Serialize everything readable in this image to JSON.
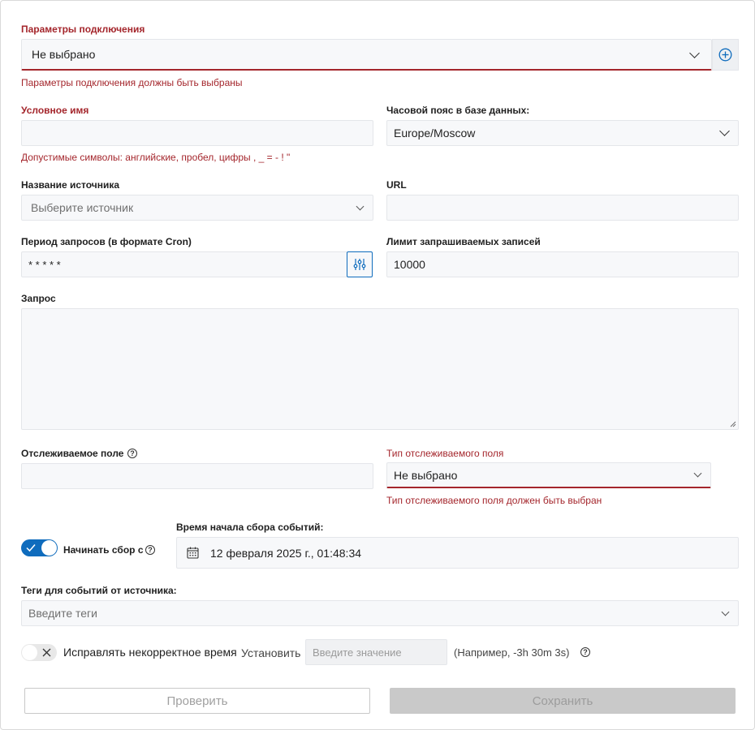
{
  "connection": {
    "label": "Параметры подключения",
    "value": "Не выбрано",
    "error": "Параметры подключения должны быть выбраны"
  },
  "alias": {
    "label": "Условное имя",
    "value": "",
    "hint": "Допустимые символы: английские, пробел, цифры , _ = - ! \""
  },
  "timezone": {
    "label": "Часовой пояс в базе данных:",
    "value": "Europe/Moscow"
  },
  "source": {
    "label": "Название источника",
    "placeholder": "Выберите источник"
  },
  "url": {
    "label": "URL",
    "value": ""
  },
  "cron": {
    "label": "Период запросов (в формате Cron)",
    "value": "* * * * *"
  },
  "limit": {
    "label": "Лимит запрашиваемых записей",
    "value": "10000"
  },
  "query": {
    "label": "Запрос",
    "value": ""
  },
  "tracked_field": {
    "label": "Отслеживаемое поле",
    "value": ""
  },
  "tracked_type": {
    "label": "Тип отслеживаемого поля",
    "value": "Не выбрано",
    "error": "Тип отслеживаемого поля должен быть выбран"
  },
  "start_collect": {
    "toggle_label": "Начинать сбор с",
    "toggle_on": true,
    "time_label": "Время начала сбора событий:",
    "time_value": "12 февраля 2025 г., 01:48:34"
  },
  "tags": {
    "label": "Теги для событий от источника:",
    "placeholder": "Введите теги"
  },
  "fix_time": {
    "toggle_label": "Исправлять некорректное время",
    "toggle_on": false,
    "set_label": "Установить",
    "placeholder": "Введите значение",
    "example": "(Например, -3h 30m 3s)"
  },
  "buttons": {
    "check": "Проверить",
    "save": "Сохранить"
  },
  "colors": {
    "accent": "#0f6cbd",
    "error": "#a4262c",
    "field_bg": "#f7f8fa"
  }
}
